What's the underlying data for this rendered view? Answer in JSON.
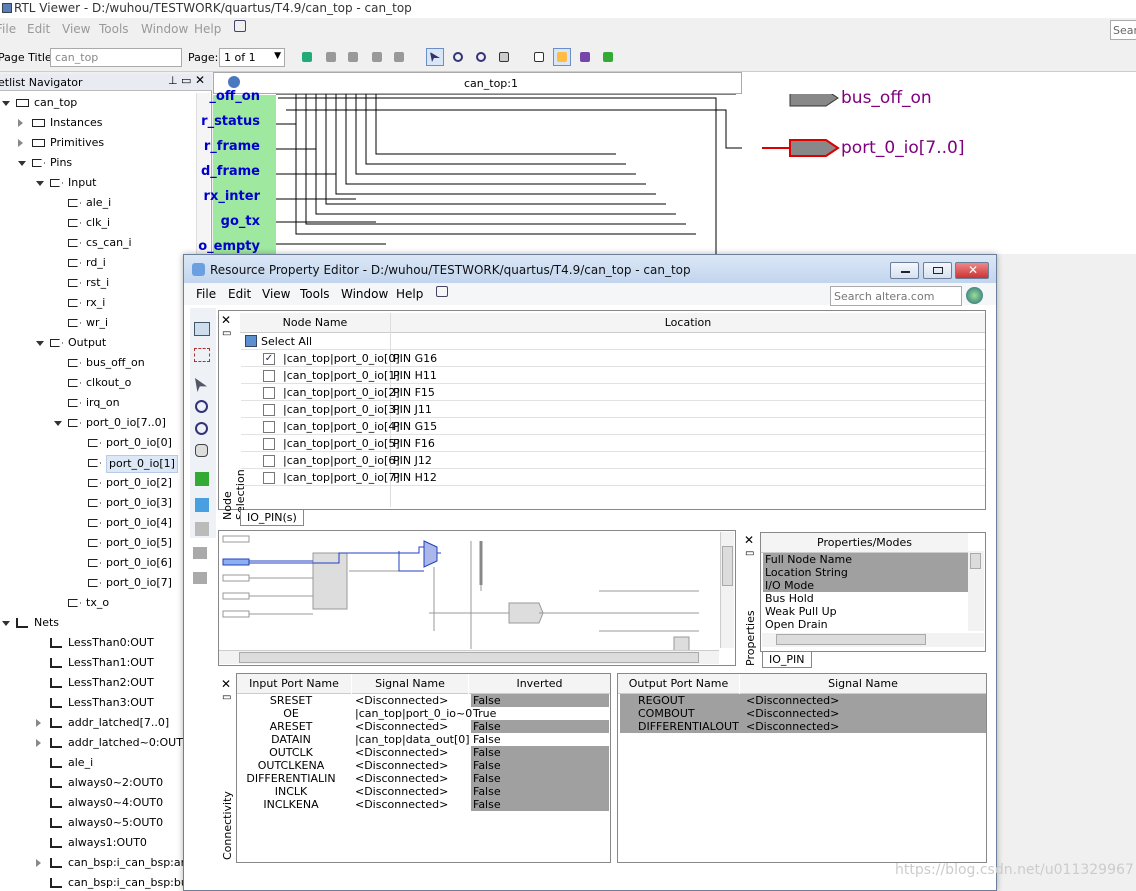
{
  "app": {
    "title": "RTL Viewer - D:/wuhou/TESTWORK/quartus/T4.9/can_top - can_top",
    "menu": [
      "File",
      "Edit",
      "View",
      "Tools",
      "Window",
      "Help"
    ],
    "search_placeholder": "Sear"
  },
  "toolbar": {
    "page_title_label": "Page Title:",
    "page_title_value": "can_top",
    "page_label": "Page:",
    "page_value": "1 of 1"
  },
  "navigator": {
    "title": "etlist Navigator",
    "items": [
      {
        "label": "can_top",
        "level": 0,
        "icon": "hierarchy-icon",
        "expand": "down"
      },
      {
        "label": "Instances",
        "level": 1,
        "icon": "instance-icon",
        "expand": "right"
      },
      {
        "label": "Primitives",
        "level": 1,
        "icon": "primitive-icon",
        "expand": "right"
      },
      {
        "label": "Pins",
        "level": 1,
        "icon": "pin-icon",
        "expand": "down"
      },
      {
        "label": "Input",
        "level": 2,
        "icon": "pin-icon",
        "expand": "down"
      },
      {
        "label": "ale_i",
        "level": 3,
        "icon": "pin-icon"
      },
      {
        "label": "clk_i",
        "level": 3,
        "icon": "pin-icon"
      },
      {
        "label": "cs_can_i",
        "level": 3,
        "icon": "pin-icon"
      },
      {
        "label": "rd_i",
        "level": 3,
        "icon": "pin-icon"
      },
      {
        "label": "rst_i",
        "level": 3,
        "icon": "pin-icon"
      },
      {
        "label": "rx_i",
        "level": 3,
        "icon": "pin-icon"
      },
      {
        "label": "wr_i",
        "level": 3,
        "icon": "pin-icon"
      },
      {
        "label": "Output",
        "level": 2,
        "icon": "pin-icon",
        "expand": "down"
      },
      {
        "label": "bus_off_on",
        "level": 3,
        "icon": "pin-icon"
      },
      {
        "label": "clkout_o",
        "level": 3,
        "icon": "pin-icon"
      },
      {
        "label": "irq_on",
        "level": 3,
        "icon": "pin-icon"
      },
      {
        "label": "port_0_io[7..0]",
        "level": 3,
        "icon": "pin-icon",
        "expand": "down"
      },
      {
        "label": "port_0_io[0]",
        "level": 4,
        "icon": "pin-icon"
      },
      {
        "label": "port_0_io[1]",
        "level": 4,
        "icon": "pin-icon",
        "selected": true
      },
      {
        "label": "port_0_io[2]",
        "level": 4,
        "icon": "pin-icon"
      },
      {
        "label": "port_0_io[3]",
        "level": 4,
        "icon": "pin-icon"
      },
      {
        "label": "port_0_io[4]",
        "level": 4,
        "icon": "pin-icon"
      },
      {
        "label": "port_0_io[5]",
        "level": 4,
        "icon": "pin-icon"
      },
      {
        "label": "port_0_io[6]",
        "level": 4,
        "icon": "pin-icon"
      },
      {
        "label": "port_0_io[7]",
        "level": 4,
        "icon": "pin-icon"
      },
      {
        "label": "tx_o",
        "level": 3,
        "icon": "pin-icon"
      },
      {
        "label": "Nets",
        "level": 0,
        "icon": "net-icon",
        "expand": "down"
      },
      {
        "label": "LessThan0:OUT",
        "level": 2,
        "icon": "net-icon"
      },
      {
        "label": "LessThan1:OUT",
        "level": 2,
        "icon": "net-icon"
      },
      {
        "label": "LessThan2:OUT",
        "level": 2,
        "icon": "net-icon"
      },
      {
        "label": "LessThan3:OUT",
        "level": 2,
        "icon": "net-icon"
      },
      {
        "label": "addr_latched[7..0]",
        "level": 2,
        "icon": "net-icon",
        "expand": "right"
      },
      {
        "label": "addr_latched~0:OUT[",
        "level": 2,
        "icon": "net-icon",
        "expand": "right"
      },
      {
        "label": "ale_i",
        "level": 2,
        "icon": "net-icon"
      },
      {
        "label": "always0~2:OUT0",
        "level": 2,
        "icon": "net-icon"
      },
      {
        "label": "always0~4:OUT0",
        "level": 2,
        "icon": "net-icon"
      },
      {
        "label": "always0~5:OUT0",
        "level": 2,
        "icon": "net-icon"
      },
      {
        "label": "always1:OUT0",
        "level": 2,
        "icon": "net-icon"
      },
      {
        "label": "can_bsp:i_can_bsp:ar",
        "level": 2,
        "icon": "net-icon",
        "expand": "right"
      },
      {
        "label": "can_bsp:i_can_bsp:bu",
        "level": 2,
        "icon": "net-icon"
      }
    ]
  },
  "schematic": {
    "tab": "can_top:1",
    "input_labels": [
      "_off_on",
      "r_status",
      "r_frame",
      "d_frame",
      "rx_inter",
      "go_tx",
      "o_empty"
    ],
    "output_pins": [
      "bus_off_on",
      "port_0_io[7..0]"
    ]
  },
  "editor": {
    "title": "Resource Property Editor - D:/wuhou/TESTWORK/quartus/T4.9/can_top - can_top",
    "menu": [
      "File",
      "Edit",
      "View",
      "Tools",
      "Window",
      "Help"
    ],
    "search_placeholder": "Search altera.com",
    "node_selection": {
      "side_label": "Node Selection",
      "tab": "IO_PIN(s)",
      "col_node": "Node Name",
      "col_location": "Location",
      "select_all": "Select All",
      "rows": [
        {
          "node": "|can_top|port_0_io[0]",
          "location": "PIN G16",
          "checked": "✓"
        },
        {
          "node": "|can_top|port_0_io[1]",
          "location": "PIN H11",
          "checked": ""
        },
        {
          "node": "|can_top|port_0_io[2]",
          "location": "PIN F15",
          "checked": ""
        },
        {
          "node": "|can_top|port_0_io[3]",
          "location": "PIN J11",
          "checked": ""
        },
        {
          "node": "|can_top|port_0_io[4]",
          "location": "PIN G15",
          "checked": ""
        },
        {
          "node": "|can_top|port_0_io[5]",
          "location": "PIN F16",
          "checked": ""
        },
        {
          "node": "|can_top|port_0_io[6]",
          "location": "PIN J12",
          "checked": ""
        },
        {
          "node": "|can_top|port_0_io[7]",
          "location": "PIN H12",
          "checked": ""
        }
      ]
    },
    "properties": {
      "side_label": "Properties",
      "tab": "IO_PIN",
      "header": "Properties/Modes",
      "items": [
        {
          "label": "Full Node Name",
          "shaded": true
        },
        {
          "label": "Location String",
          "shaded": true
        },
        {
          "label": "I/O Mode",
          "shaded": true
        },
        {
          "label": "Bus Hold",
          "shaded": false
        },
        {
          "label": "Weak Pull Up",
          "shaded": false
        },
        {
          "label": "Open Drain",
          "shaded": false
        }
      ]
    },
    "connectivity": {
      "side_label": "Connectivity",
      "input_headers": [
        "Input Port Name",
        "Signal Name",
        "Inverted"
      ],
      "input_rows": [
        {
          "port": "SRESET",
          "signal": "<Disconnected>",
          "inverted": "False",
          "shaded": true
        },
        {
          "port": "OE",
          "signal": "|can_top|port_0_io~0",
          "inverted": "True",
          "shaded": false
        },
        {
          "port": "ARESET",
          "signal": "<Disconnected>",
          "inverted": "False",
          "shaded": true
        },
        {
          "port": "DATAIN",
          "signal": "|can_top|data_out[0]",
          "inverted": "False",
          "shaded": false
        },
        {
          "port": "OUTCLK",
          "signal": "<Disconnected>",
          "inverted": "False",
          "shaded": true
        },
        {
          "port": "OUTCLKENA",
          "signal": "<Disconnected>",
          "inverted": "False",
          "shaded": true
        },
        {
          "port": "DIFFERENTIALIN",
          "signal": "<Disconnected>",
          "inverted": "False",
          "shaded": true
        },
        {
          "port": "INCLK",
          "signal": "<Disconnected>",
          "inverted": "False",
          "shaded": true
        },
        {
          "port": "INCLKENA",
          "signal": "<Disconnected>",
          "inverted": "False",
          "shaded": true
        }
      ],
      "output_headers": [
        "Output Port Name",
        "Signal Name"
      ],
      "output_rows": [
        {
          "port": "REGOUT",
          "signal": "<Disconnected>"
        },
        {
          "port": "COMBOUT",
          "signal": "<Disconnected>"
        },
        {
          "port": "DIFFERENTIALOUT",
          "signal": "<Disconnected>"
        }
      ]
    }
  },
  "watermark": "https://blog.csdn.net/u011329967"
}
